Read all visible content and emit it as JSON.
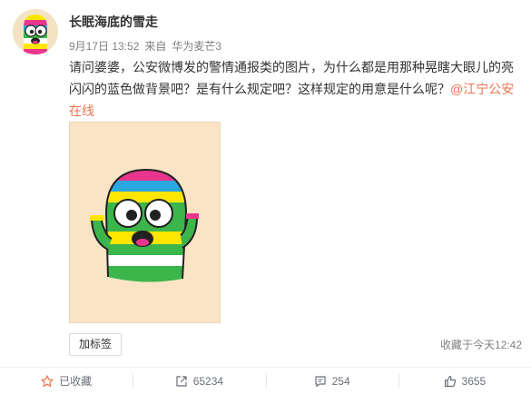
{
  "post": {
    "username": "长眠海底的雪走",
    "date": "9月17日 13:52",
    "source_prefix": "来自",
    "source_device": "华为麦芒3",
    "text": "请问婆婆，公安微博发的警情通报类的图片，为什么都是用那种晃瞎大眼儿的亮闪闪的蓝色做背景吧？是有什么规定吧？这样规定的用意是什么呢？",
    "mention": "@江宁公安在线"
  },
  "tag_button": "加标签",
  "favorite_time": "收藏于今天12:42",
  "actions": {
    "favorite": "已收藏",
    "repost": "65234",
    "comment": "254",
    "like": "3655"
  },
  "colors": {
    "mention": "#eb7350",
    "photo_bg": "#fbe4c6",
    "meta_text": "#808080"
  },
  "icons": {
    "favorite": "star-icon",
    "repost": "share-icon",
    "comment": "comment-icon",
    "like": "thumbs-up-icon"
  }
}
